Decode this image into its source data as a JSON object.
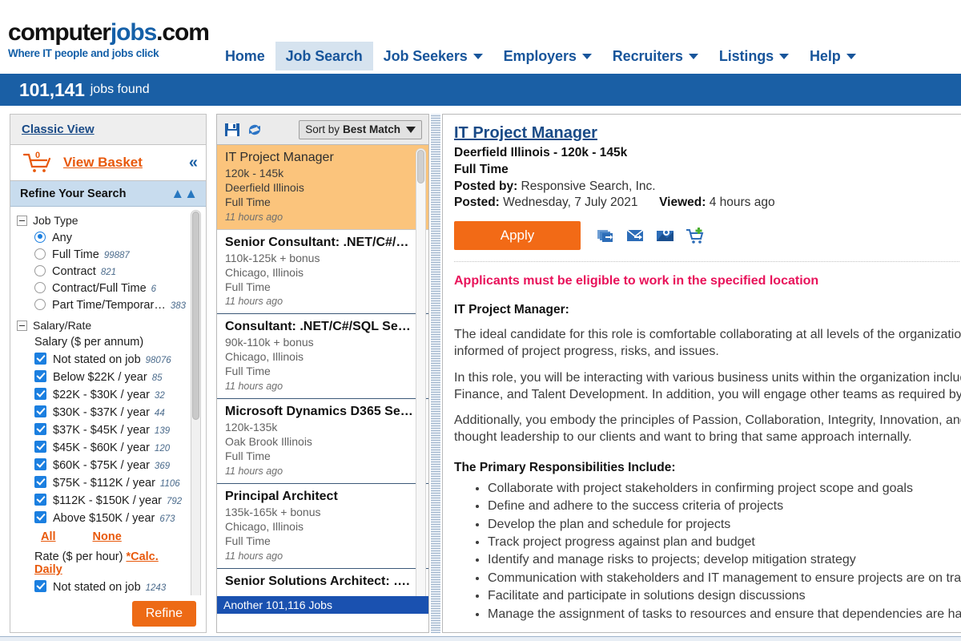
{
  "header": {
    "logo_main_1": "computer",
    "logo_main_2": "jobs",
    "logo_main_3": ".com",
    "logo_tagline": "Where IT people and jobs click",
    "nav": [
      {
        "label": "Home",
        "caret": false,
        "active": false
      },
      {
        "label": "Job Search",
        "caret": false,
        "active": true
      },
      {
        "label": "Job Seekers",
        "caret": true,
        "active": false
      },
      {
        "label": "Employers",
        "caret": true,
        "active": false
      },
      {
        "label": "Recruiters",
        "caret": true,
        "active": false
      },
      {
        "label": "Listings",
        "caret": true,
        "active": false
      },
      {
        "label": "Help",
        "caret": true,
        "active": false
      }
    ]
  },
  "jobs_bar": {
    "count": "101,141",
    "label": "jobs found",
    "background": "#1a5fa5"
  },
  "sidebar": {
    "classic_view": "Classic View",
    "basket_count": "0",
    "view_basket": "View Basket",
    "collapse_icon": "«",
    "refine_title": "Refine Your Search",
    "refine_collapse_icon": "«",
    "job_type": {
      "title": "Job Type",
      "options": [
        {
          "label": "Any",
          "count": "",
          "selected": true
        },
        {
          "label": "Full Time",
          "count": "99887",
          "selected": false
        },
        {
          "label": "Contract",
          "count": "821",
          "selected": false
        },
        {
          "label": "Contract/Full Time",
          "count": "6",
          "selected": false
        },
        {
          "label": "Part Time/Temporar…",
          "count": "383",
          "selected": false
        }
      ]
    },
    "salary_rate": {
      "title": "Salary/Rate",
      "salary_subtitle": "Salary ($ per annum)",
      "salary_options": [
        {
          "label": "Not stated on job",
          "count": "98076",
          "checked": true
        },
        {
          "label": "Below $22K / year",
          "count": "85",
          "checked": true
        },
        {
          "label": "$22K - $30K / year",
          "count": "32",
          "checked": true
        },
        {
          "label": "$30K - $37K / year",
          "count": "44",
          "checked": true
        },
        {
          "label": "$37K - $45K / year",
          "count": "139",
          "checked": true
        },
        {
          "label": "$45K - $60K / year",
          "count": "120",
          "checked": true
        },
        {
          "label": "$60K - $75K / year",
          "count": "369",
          "checked": true
        },
        {
          "label": "$75K - $112K / year",
          "count": "1106",
          "checked": true
        },
        {
          "label": "$112K - $150K / year",
          "count": "792",
          "checked": true
        },
        {
          "label": "Above $150K / year",
          "count": "673",
          "checked": true
        }
      ],
      "all_label": "All",
      "none_label": "None",
      "rate_subtitle": "Rate ($ per hour)",
      "rate_calc_link": "*Calc. Daily",
      "rate_options": [
        {
          "label": "Not stated on job",
          "count": "1243",
          "checked": true
        }
      ]
    },
    "refine_button": "Refine",
    "refine_button_color": "#ed6a15"
  },
  "joblist": {
    "save_icon": "save-icon",
    "refresh_icon": "refresh-icon",
    "sort_prefix": "Sort by",
    "sort_value": "Best Match",
    "items": [
      {
        "title": "IT Project Manager",
        "salary": "120k - 145k",
        "location": "Deerfield Illinois",
        "type": "Full Time",
        "age": "11 hours ago",
        "selected": true
      },
      {
        "title": "Senior Consultant: .NET/C#/…",
        "salary": "110k-125k + bonus",
        "location": "Chicago, Illinois",
        "type": "Full Time",
        "age": "11 hours ago",
        "selected": false
      },
      {
        "title": "Consultant: .NET/C#/SQL Se…",
        "salary": "90k-110k + bonus",
        "location": "Chicago, Illinois",
        "type": "Full Time",
        "age": "11 hours ago",
        "selected": false
      },
      {
        "title": "Microsoft Dynamics D365 Se…",
        "salary": "120k-135k",
        "location": "Oak Brook Illinois",
        "type": "Full Time",
        "age": "11 hours ago",
        "selected": false
      },
      {
        "title": "Principal Architect",
        "salary": "135k-165k + bonus",
        "location": "Chicago, Illinois",
        "type": "Full Time",
        "age": "11 hours ago",
        "selected": false
      },
      {
        "title": "Senior Solutions Architect: ….",
        "salary": "",
        "location": "",
        "type": "",
        "age": "",
        "selected": false
      }
    ],
    "more_jobs": "Another 101,116 Jobs"
  },
  "detail": {
    "title": "IT Project Manager",
    "location_salary": "Deerfield Illinois - 120k - 145k",
    "job_type": "Full Time",
    "posted_by_label": "Posted by:",
    "posted_by_value": "Responsive Search, Inc.",
    "posted_label": "Posted:",
    "posted_value": "Wednesday, 7 July 2021",
    "viewed_label": "Viewed:",
    "viewed_value": "4 hours ago",
    "apply_button": "Apply",
    "apply_button_color": "#f26a16",
    "action_icons": [
      "share-icon",
      "email-icon",
      "map-icon",
      "add-to-basket-icon"
    ],
    "eligibility_note": "Applicants must be eligible to work in the specified location",
    "eligibility_color": "#e8125a",
    "role_heading": "IT Project Manager:",
    "paragraph_1": "The ideal candidate for this role is comfortable collaborating at all levels of the organization and keeping stakeholders and Management informed of project progress, risks, and issues.",
    "paragraph_2": "In this role, you will be interacting with various business units within the organization including Client Services, Warehouse Operations, Finance, and Talent Development. In addition, you will engage other teams as required by your projects.",
    "paragraph_3": "Additionally, you embody the principles of Passion, Collaboration, Integrity, Innovation, and Excellence. We provide excellent service and thought leadership to our clients and want to bring that same approach internally.",
    "responsibilities_heading": "The Primary Responsibilities Include:",
    "responsibilities": [
      "Collaborate with project stakeholders in confirming project scope and goals",
      "Define and adhere to the success criteria of projects",
      "Develop the plan and schedule for projects",
      "Track project progress against plan and budget",
      "Identify and manage risks to projects; develop mitigation strategy",
      "Communication with stakeholders and IT management to ensure projects are on track",
      "Facilitate and participate in solutions design discussions",
      "Manage the assignment of tasks to resources and ensure that dependencies are handled"
    ]
  }
}
